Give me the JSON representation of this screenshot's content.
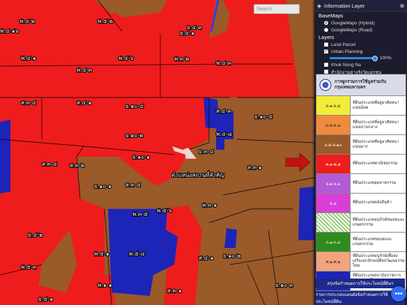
{
  "panel": {
    "title": "Information Layer",
    "basemaps_heading": "BaseMaps",
    "basemaps": [
      {
        "label": "GoogleMaps (Hybrid)",
        "selected": true
      },
      {
        "label": "GoogleMaps (Road)",
        "selected": false
      }
    ],
    "layers_heading": "Layers",
    "layers": [
      {
        "label": "Land Parcel",
        "checked": false
      },
      {
        "label": "Urban Planning",
        "checked": true
      }
    ],
    "opacity_label": "100%",
    "opacity_value": 1.0,
    "extra_layers": [
      {
        "label": "Khok Nong Na",
        "checked": false
      },
      {
        "label": "สำนักงานย่างรังวัดเอกชน",
        "checked": false
      }
    ]
  },
  "legend": {
    "header": "การผูกรวมการใช้มูลร่วมกับกรุงเทพมหานคร",
    "items": [
      {
        "code": "ย.๑-ย.๔",
        "color": "#f2ec3a",
        "text": "ที่ดินประเภทที่อยู่อาศัยหนาแน่นน้อย"
      },
      {
        "code": "ย.๕-ย.๗",
        "color": "#f08a3c",
        "text": "ที่ดินประเภทที่อยู่อาศัยหนาแน่นปานกลาง"
      },
      {
        "code": "ย.๘-ย.๑๐",
        "color": "#9a5a2a",
        "text": "ที่ดินประเภทที่อยู่อาศัยหนาแน่นมาก"
      },
      {
        "code": "พ.๑-พ.๕",
        "color": "#ee1c1c",
        "text": "ที่ดินประเภทพาณิชยกรรม"
      },
      {
        "code": "อ.๑-อ.๓",
        "color": "#b35ad6",
        "text": "ที่ดินประเภทอุตสาหกรรม"
      },
      {
        "code": "อ.๔",
        "color": "#d93fd6",
        "text": "ที่ดินประเภทคลังสินค้า"
      },
      {
        "code": "",
        "color": "#e9f5e0",
        "text": "ที่ดินประเภทอนุรักษ์ชนบทและเกษตรกรรม"
      },
      {
        "code": "ก.๑-ก.๔",
        "color": "#2e8b1e",
        "text": "ที่ดินประเภทชนบทและเกษตรกรรม"
      },
      {
        "code": "ศ.๑-ศ.๒",
        "color": "#f3a47c",
        "text": "ที่ดินประเภทอนุรักษ์เพื่อส่งเสริมเอกลักษณ์ศิลปวัฒนธรรมไทย"
      },
      {
        "code": "ส",
        "color": "#1d24b8",
        "text": "ที่ดินประเภทสถาบันราชการ สาธารณูปโภคและสาธารณูปการ"
      }
    ],
    "footer1": "สรุปข้อกำหนดการใช้ประโยชน์ที่ดินฯ",
    "footer2": "รายการประกอบแผนผังข้อกำหนดการใช้ประโยชน์ที่ดิน"
  },
  "map": {
    "search_placeholder": "Search",
    "place_label": "ตำแหน่งสถานที่สำคัญ",
    "zone_labels": [
      "พ.๔-๒",
      "พ.๕-๒",
      "ย.๔-๓",
      "ย.๔-๑",
      "พ.๔-๑๖",
      "พ.๔-๑",
      "พ.๔-๖",
      "พ.๓-๒",
      "พ.๔-๓",
      "พ.๔-๓",
      "ส.๓-๔",
      "ส.๔-๑",
      "ย.๑๐-๔",
      "ส.๔-๓",
      "พ.๔-๘",
      "ย.๑๐-๕",
      "ย.๑๐-๒",
      "ย.๓-๔",
      "ย.๑๐-๑",
      "ส.๓-๑",
      "ส.๓-๒",
      "ส.๓-๔",
      "ย.๑๐-๑",
      "ส.๓-๕",
      "พ.๓-๑",
      "พ.๓-๕",
      "พ.๕-๖",
      "ย.๔-๒",
      "พ.๕-๓",
      "พ.๕-๑",
      "พ.๕-๔",
      "ส.๔-๑",
      "ย.๑๐-๒",
      "พ.๑-๑",
      "ย.๕-๑",
      "ย.๑๐-๓",
      "ส.๓-๑"
    ]
  },
  "chat_icon": "chat-bubble-icon",
  "accent_color": "#2f6df0"
}
